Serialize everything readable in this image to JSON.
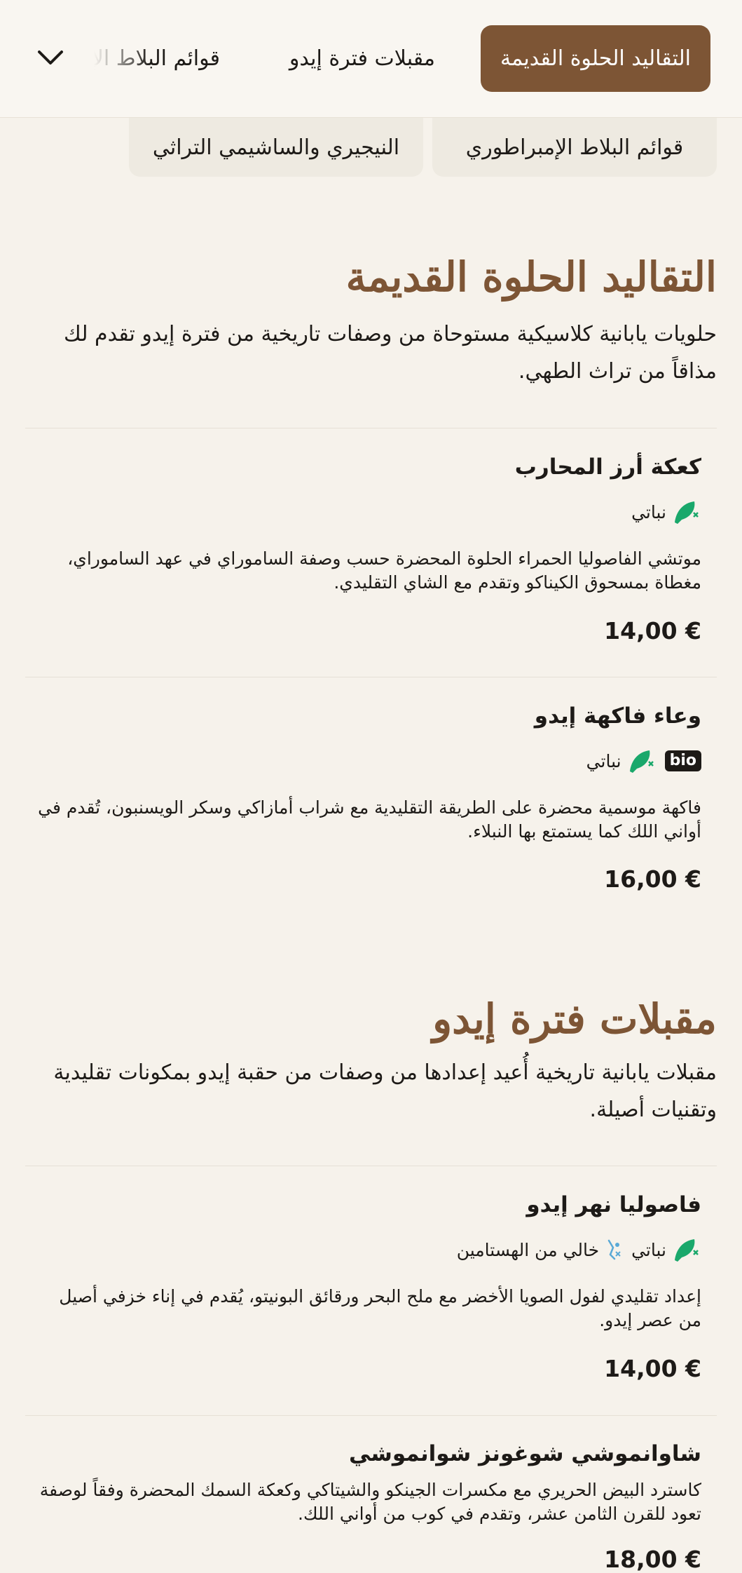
{
  "nav": {
    "tabs": [
      {
        "label": "التقاليد الحلوة القديمة"
      },
      {
        "label": "مقبلات فترة إيدو"
      },
      {
        "label": "قوائم البلاط الإمبراطوري"
      }
    ],
    "more_icon": "chevron-down-icon"
  },
  "subtabs": [
    {
      "label": "قوائم البلاط الإمبراطوري"
    },
    {
      "label": "النيجيري والساشيمي التراثي"
    }
  ],
  "sections": [
    {
      "title": "التقاليد الحلوة القديمة",
      "description": "حلويات يابانية كلاسيكية مستوحاة من وصفات تاريخية من فترة إيدو تقدم لك مذاقاً من تراث الطهي.",
      "items": [
        {
          "name": "كعكة أرز المحارب",
          "tags": [
            "نباتي"
          ],
          "description": "موتشي الفاصوليا الحمراء الحلوة المحضرة حسب وصفة الساموراي في عهد الساموراي، مغطاة بمسحوق الكيناكو وتقدم مع الشاي التقليدي.",
          "price": "14,00 €"
        },
        {
          "name": "وعاء فاكهة إيدو",
          "badge": "bio",
          "tags": [
            "نباتي"
          ],
          "description": "فاكهة موسمية محضرة على الطريقة التقليدية مع شراب أمازاكي وسكر الويسنبون، تُقدم في أواني اللك كما يستمتع بها النبلاء.",
          "price": "16,00 €"
        }
      ]
    },
    {
      "title": "مقبلات فترة إيدو",
      "description": "مقبلات يابانية تاريخية أُعيد إعدادها من وصفات من حقبة إيدو بمكونات تقليدية وتقنيات أصيلة.",
      "items": [
        {
          "name": "فاصوليا نهر إيدو",
          "tags": [
            "نباتي",
            "خالي من الهستامين"
          ],
          "description": "إعداد تقليدي لفول الصويا الأخضر مع ملح البحر ورقائق البونيتو، يُقدم في إناء خزفي أصيل من عصر إيدو.",
          "price": "14,00 €"
        },
        {
          "name": "شاوانموشي شوغونز شوانموشي",
          "description": "كاسترد البيض الحريري مع مكسرات الجينكو والشيتاكي وكعكة السمك المحضرة وفقاً لوصفة تعود للقرن الثامن عشر، وتقدم في كوب من أواني اللك.",
          "price": "18,00 €"
        }
      ]
    }
  ],
  "colors": {
    "accent": "#7d5535",
    "background": "#f6f2eb",
    "vegan_green": "#1aa86b"
  }
}
